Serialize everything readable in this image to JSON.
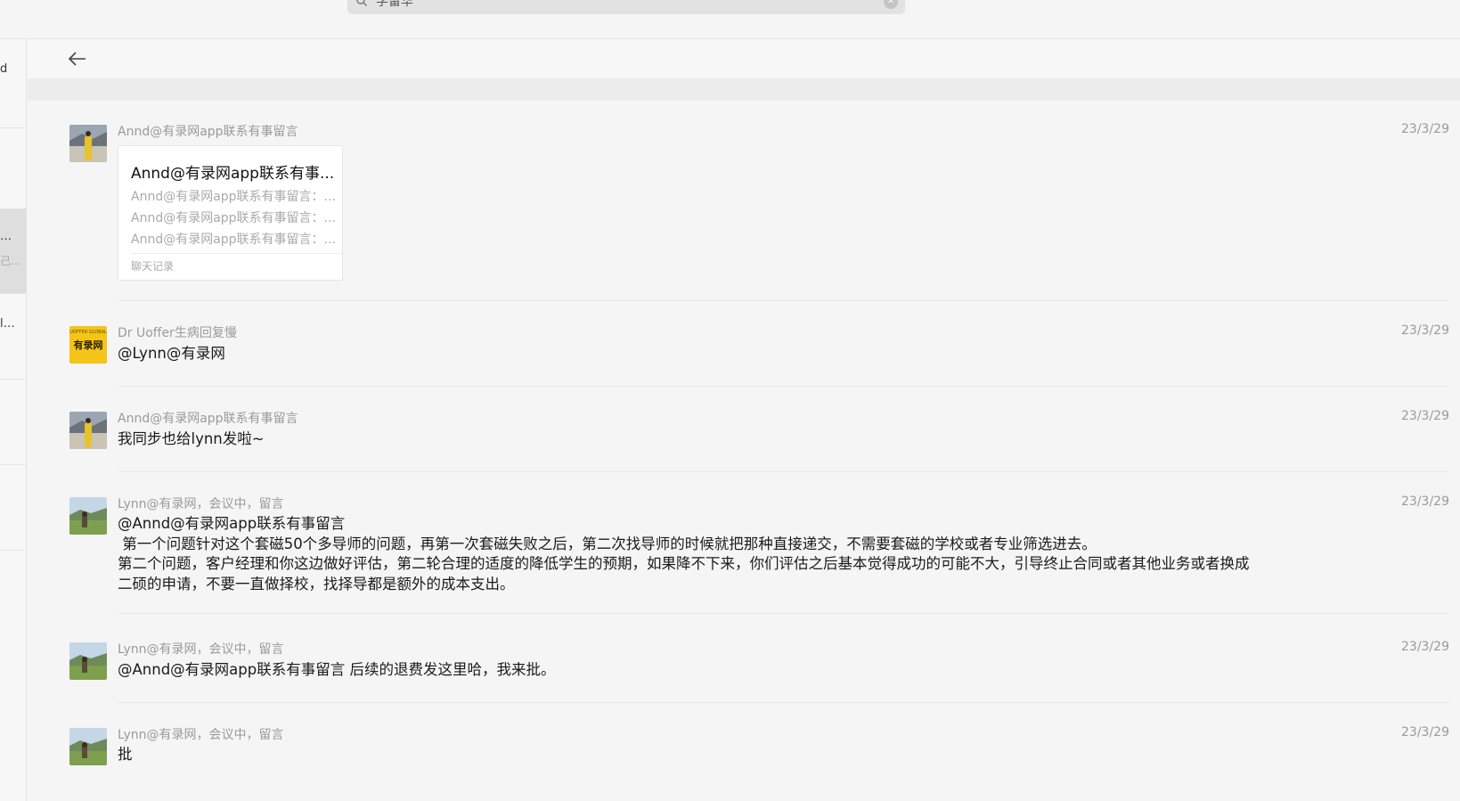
{
  "search": {
    "query": "学留华"
  },
  "left_list": {
    "frag1": "d",
    "frag2": "…",
    "frag3": "己…",
    "frag4": "l…"
  },
  "messages": [
    {
      "sender": "Annd@有录网app联系有事留言",
      "date": "23/3/29",
      "card": {
        "title": "Annd@有录网app联系有事...",
        "lines": [
          "Annd@有录网app联系有事留言：...",
          "Annd@有录网app联系有事留言：...",
          "Annd@有录网app联系有事留言：..."
        ],
        "footer": "聊天记录"
      }
    },
    {
      "sender": "Dr Uoffer生病回复慢",
      "date": "23/3/29",
      "text": "@Lynn@有录网",
      "avatar_label": "有录网"
    },
    {
      "sender": "Annd@有录网app联系有事留言",
      "date": "23/3/29",
      "text": "我同步也给lynn发啦~"
    },
    {
      "sender": "Lynn@有录网，会议中，留言",
      "date": "23/3/29",
      "text_lines": [
        "@Annd@有录网app联系有事留言",
        " 第一个问题针对这个套磁50个多导师的问题，再第一次套磁失败之后，第二次找导师的时候就把那种直接递交，不需要套磁的学校或者专业筛选进去。",
        "第二个问题，客户经理和你这边做好评估，第二轮合理的适度的降低学生的预期，如果降不下来，你们评估之后基本觉得成功的可能不大，引导终止合同或者其他业务或者换成",
        "二硕的申请，不要一直做择校，找择导都是额外的成本支出。"
      ]
    },
    {
      "sender": "Lynn@有录网，会议中，留言",
      "date": "23/3/29",
      "text": "@Annd@有录网app联系有事留言 后续的退费发这里哈，我来批。"
    },
    {
      "sender": "Lynn@有录网，会议中，留言",
      "date": "23/3/29",
      "text": "批"
    }
  ]
}
